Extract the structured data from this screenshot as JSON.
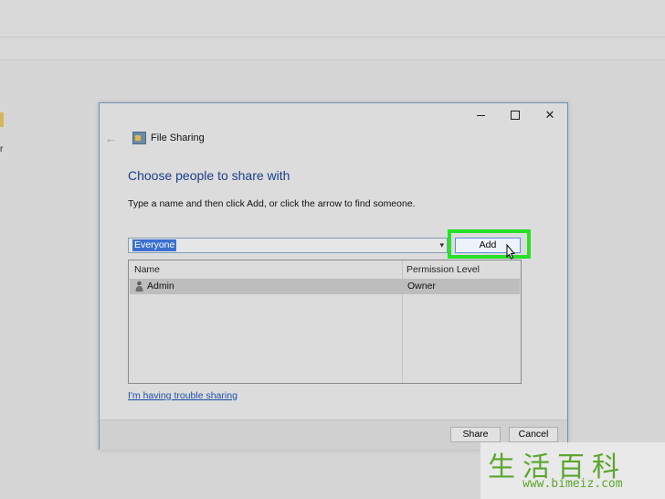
{
  "background": {
    "partial_label": "r"
  },
  "dialog": {
    "title": "File Sharing",
    "heading": "Choose people to share with",
    "instruction": "Type a name and then click Add, or click the arrow to find someone.",
    "name_combo": {
      "value": "Everyone"
    },
    "add_button": "Add",
    "table": {
      "columns": [
        "Name",
        "Permission Level"
      ],
      "rows": [
        {
          "name": "Admin",
          "permission": "Owner"
        }
      ]
    },
    "trouble_link": "I'm having trouble sharing",
    "share_button": "Share",
    "cancel_button": "Cancel"
  },
  "watermark": {
    "chars": "生活百科",
    "url": "www.bimeiz.com"
  },
  "colors": {
    "highlight": "#28e028",
    "heading_blue": "#1a3e8a",
    "link_blue": "#1a4fa8",
    "selection_blue": "#3a6fd0"
  }
}
